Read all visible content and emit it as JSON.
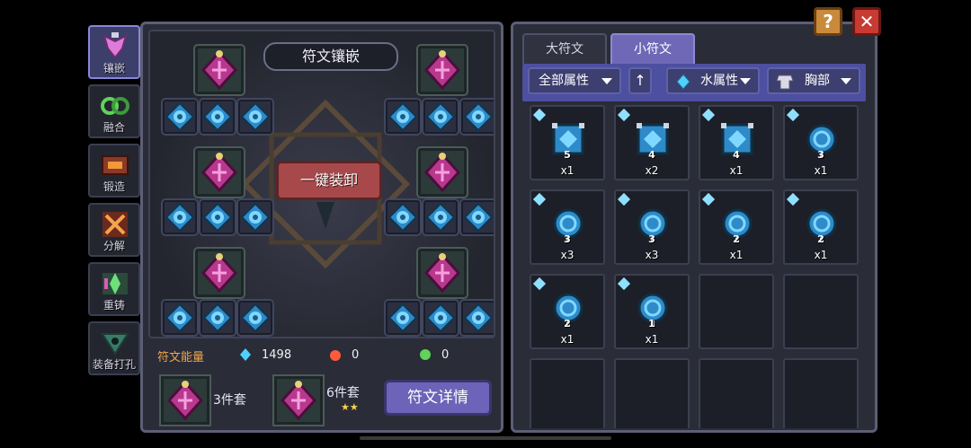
{
  "side_tabs": [
    {
      "label": "镶嵌",
      "icon": "inlay-gem-icon",
      "active": true
    },
    {
      "label": "融合",
      "icon": "fusion-ring-icon",
      "active": false
    },
    {
      "label": "锻造",
      "icon": "forge-anvil-icon",
      "active": false
    },
    {
      "label": "分解",
      "icon": "decompose-icon",
      "active": false
    },
    {
      "label": "重铸",
      "icon": "recast-crystal-icon",
      "active": false
    },
    {
      "label": "装备打孔",
      "icon": "equip-punch-icon",
      "active": false
    }
  ],
  "inlay": {
    "title": "符文镶嵌",
    "unload_all_label": "一键装卸",
    "big_rune_icon": "pink-big-rune-icon",
    "small_rune_icon": "blue-small-rune-icon"
  },
  "energy": {
    "label": "符文能量",
    "water": "1498",
    "fire": "0",
    "wood": "0"
  },
  "sets": [
    {
      "label": "3件套",
      "stars": ""
    },
    {
      "label": "6件套",
      "stars": "★★"
    }
  ],
  "detail_button_label": "符文详情",
  "tabs": [
    {
      "label": "大符文",
      "active": false
    },
    {
      "label": "小符文",
      "active": true
    }
  ],
  "filters": {
    "all_attr": "全部属性",
    "sort_icon": "up-arrow-icon",
    "water_attr": "水属性",
    "slot": "胸部"
  },
  "inventory": [
    {
      "style": "square",
      "level": "5",
      "count": "x1"
    },
    {
      "style": "square",
      "level": "4",
      "count": "x2"
    },
    {
      "style": "square",
      "level": "4",
      "count": "x1"
    },
    {
      "style": "round",
      "level": "3",
      "count": "x1"
    },
    {
      "style": "round",
      "level": "3",
      "count": "x3"
    },
    {
      "style": "round",
      "level": "3",
      "count": "x3"
    },
    {
      "style": "round",
      "level": "2",
      "count": "x1"
    },
    {
      "style": "round",
      "level": "2",
      "count": "x1"
    },
    {
      "style": "round",
      "level": "2",
      "count": "x1"
    },
    {
      "style": "round",
      "level": "1",
      "count": "x1"
    },
    {
      "style": "empty",
      "level": "",
      "count": ""
    },
    {
      "style": "empty",
      "level": "",
      "count": ""
    },
    {
      "style": "empty",
      "level": "",
      "count": ""
    },
    {
      "style": "empty",
      "level": "",
      "count": ""
    },
    {
      "style": "empty",
      "level": "",
      "count": ""
    },
    {
      "style": "empty",
      "level": "",
      "count": ""
    }
  ],
  "help_label": "?",
  "close_label": "✕",
  "colors": {
    "accent": "#6f68b6",
    "water": "#4fd0ff",
    "fire": "#ff5a3a",
    "wood": "#5fd35a",
    "danger": "#c83b32"
  }
}
